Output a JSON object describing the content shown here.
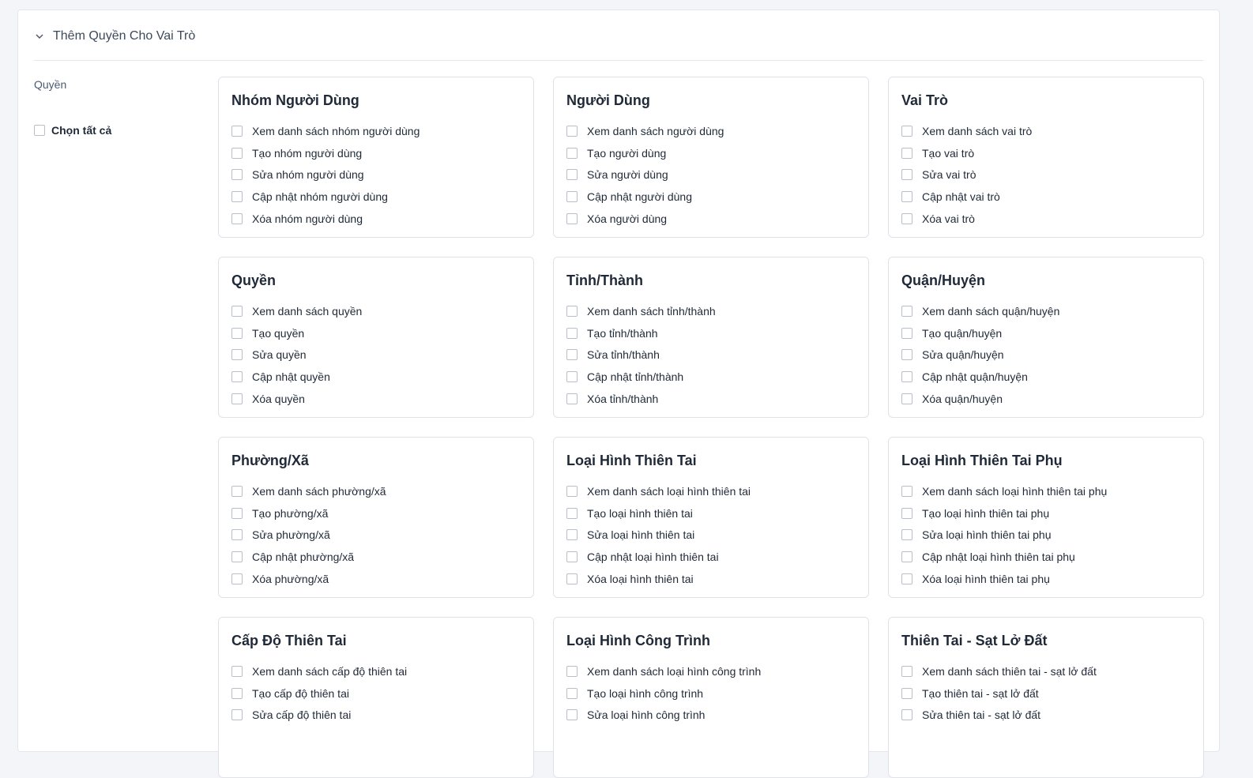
{
  "section": {
    "title": "Thêm Quyền Cho Vai Trò",
    "field_label": "Quyền",
    "select_all_label": "Chọn tất cả"
  },
  "groups": [
    {
      "title": "Nhóm Người Dùng",
      "items": [
        "Xem danh sách nhóm người dùng",
        "Tạo nhóm người dùng",
        "Sửa nhóm người dùng",
        "Cập nhật nhóm người dùng",
        "Xóa nhóm người dùng"
      ]
    },
    {
      "title": "Người Dùng",
      "items": [
        "Xem danh sách người dùng",
        "Tạo người dùng",
        "Sửa người dùng",
        "Cập nhật người dùng",
        "Xóa người dùng"
      ]
    },
    {
      "title": "Vai Trò",
      "items": [
        "Xem danh sách vai trò",
        "Tạo vai trò",
        "Sửa vai trò",
        "Cập nhật vai trò",
        "Xóa vai trò"
      ]
    },
    {
      "title": "Quyền",
      "items": [
        "Xem danh sách quyền",
        "Tạo quyền",
        "Sửa quyền",
        "Cập nhật quyền",
        "Xóa quyền"
      ]
    },
    {
      "title": "Tỉnh/Thành",
      "items": [
        "Xem danh sách tỉnh/thành",
        "Tạo tỉnh/thành",
        "Sửa tỉnh/thành",
        "Cập nhật tỉnh/thành",
        "Xóa tỉnh/thành"
      ]
    },
    {
      "title": "Quận/Huyện",
      "items": [
        "Xem danh sách quận/huyện",
        "Tạo quận/huyện",
        "Sửa quận/huyện",
        "Cập nhật quận/huyện",
        "Xóa quận/huyện"
      ]
    },
    {
      "title": "Phường/Xã",
      "items": [
        "Xem danh sách phường/xã",
        "Tạo phường/xã",
        "Sửa phường/xã",
        "Cập nhật phường/xã",
        "Xóa phường/xã"
      ]
    },
    {
      "title": "Loại Hình Thiên Tai",
      "items": [
        "Xem danh sách loại hình thiên tai",
        "Tạo loại hình thiên tai",
        "Sửa loại hình thiên tai",
        "Cập nhật loại hình thiên tai",
        "Xóa loại hình thiên tai"
      ]
    },
    {
      "title": "Loại Hình Thiên Tai Phụ",
      "items": [
        "Xem danh sách loại hình thiên tai phụ",
        "Tạo loại hình thiên tai phụ",
        "Sửa loại hình thiên tai phụ",
        "Cập nhật loại hình thiên tai phụ",
        "Xóa loại hình thiên tai phụ"
      ]
    },
    {
      "title": "Cấp Độ Thiên Tai",
      "items": [
        "Xem danh sách cấp độ thiên tai",
        "Tạo cấp độ thiên tai",
        "Sửa cấp độ thiên tai"
      ]
    },
    {
      "title": "Loại Hình Công Trình",
      "items": [
        "Xem danh sách loại hình công trình",
        "Tạo loại hình công trình",
        "Sửa loại hình công trình"
      ]
    },
    {
      "title": "Thiên Tai - Sạt Lở Đất",
      "items": [
        "Xem danh sách thiên tai - sạt lở đất",
        "Tạo thiên tai - sạt lở đất",
        "Sửa thiên tai - sạt lở đất"
      ]
    }
  ]
}
